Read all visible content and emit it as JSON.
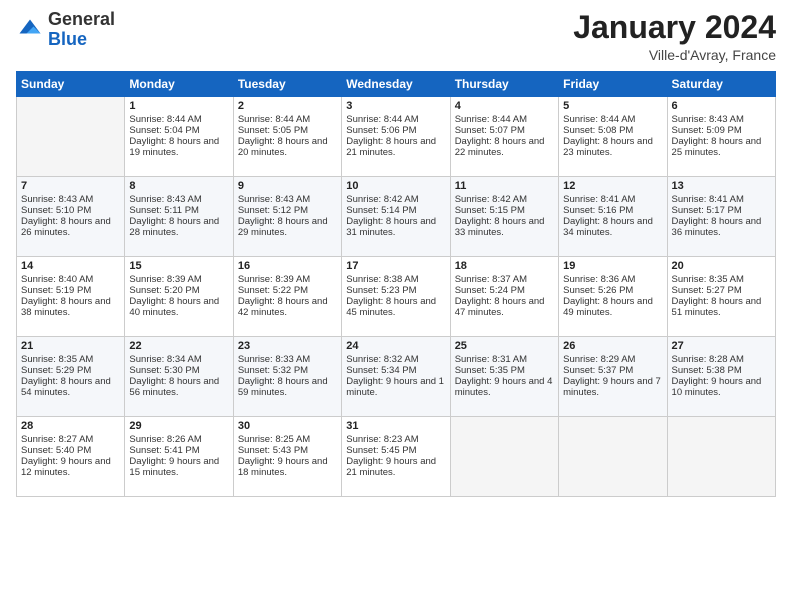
{
  "logo": {
    "general": "General",
    "blue": "Blue"
  },
  "header": {
    "month": "January 2024",
    "location": "Ville-d'Avray, France"
  },
  "days_of_week": [
    "Sunday",
    "Monday",
    "Tuesday",
    "Wednesday",
    "Thursday",
    "Friday",
    "Saturday"
  ],
  "weeks": [
    [
      {
        "day": "",
        "content": ""
      },
      {
        "day": "1",
        "sunrise": "Sunrise: 8:44 AM",
        "sunset": "Sunset: 5:04 PM",
        "daylight": "Daylight: 8 hours and 19 minutes."
      },
      {
        "day": "2",
        "sunrise": "Sunrise: 8:44 AM",
        "sunset": "Sunset: 5:05 PM",
        "daylight": "Daylight: 8 hours and 20 minutes."
      },
      {
        "day": "3",
        "sunrise": "Sunrise: 8:44 AM",
        "sunset": "Sunset: 5:06 PM",
        "daylight": "Daylight: 8 hours and 21 minutes."
      },
      {
        "day": "4",
        "sunrise": "Sunrise: 8:44 AM",
        "sunset": "Sunset: 5:07 PM",
        "daylight": "Daylight: 8 hours and 22 minutes."
      },
      {
        "day": "5",
        "sunrise": "Sunrise: 8:44 AM",
        "sunset": "Sunset: 5:08 PM",
        "daylight": "Daylight: 8 hours and 23 minutes."
      },
      {
        "day": "6",
        "sunrise": "Sunrise: 8:43 AM",
        "sunset": "Sunset: 5:09 PM",
        "daylight": "Daylight: 8 hours and 25 minutes."
      }
    ],
    [
      {
        "day": "7",
        "sunrise": "Sunrise: 8:43 AM",
        "sunset": "Sunset: 5:10 PM",
        "daylight": "Daylight: 8 hours and 26 minutes."
      },
      {
        "day": "8",
        "sunrise": "Sunrise: 8:43 AM",
        "sunset": "Sunset: 5:11 PM",
        "daylight": "Daylight: 8 hours and 28 minutes."
      },
      {
        "day": "9",
        "sunrise": "Sunrise: 8:43 AM",
        "sunset": "Sunset: 5:12 PM",
        "daylight": "Daylight: 8 hours and 29 minutes."
      },
      {
        "day": "10",
        "sunrise": "Sunrise: 8:42 AM",
        "sunset": "Sunset: 5:14 PM",
        "daylight": "Daylight: 8 hours and 31 minutes."
      },
      {
        "day": "11",
        "sunrise": "Sunrise: 8:42 AM",
        "sunset": "Sunset: 5:15 PM",
        "daylight": "Daylight: 8 hours and 33 minutes."
      },
      {
        "day": "12",
        "sunrise": "Sunrise: 8:41 AM",
        "sunset": "Sunset: 5:16 PM",
        "daylight": "Daylight: 8 hours and 34 minutes."
      },
      {
        "day": "13",
        "sunrise": "Sunrise: 8:41 AM",
        "sunset": "Sunset: 5:17 PM",
        "daylight": "Daylight: 8 hours and 36 minutes."
      }
    ],
    [
      {
        "day": "14",
        "sunrise": "Sunrise: 8:40 AM",
        "sunset": "Sunset: 5:19 PM",
        "daylight": "Daylight: 8 hours and 38 minutes."
      },
      {
        "day": "15",
        "sunrise": "Sunrise: 8:39 AM",
        "sunset": "Sunset: 5:20 PM",
        "daylight": "Daylight: 8 hours and 40 minutes."
      },
      {
        "day": "16",
        "sunrise": "Sunrise: 8:39 AM",
        "sunset": "Sunset: 5:22 PM",
        "daylight": "Daylight: 8 hours and 42 minutes."
      },
      {
        "day": "17",
        "sunrise": "Sunrise: 8:38 AM",
        "sunset": "Sunset: 5:23 PM",
        "daylight": "Daylight: 8 hours and 45 minutes."
      },
      {
        "day": "18",
        "sunrise": "Sunrise: 8:37 AM",
        "sunset": "Sunset: 5:24 PM",
        "daylight": "Daylight: 8 hours and 47 minutes."
      },
      {
        "day": "19",
        "sunrise": "Sunrise: 8:36 AM",
        "sunset": "Sunset: 5:26 PM",
        "daylight": "Daylight: 8 hours and 49 minutes."
      },
      {
        "day": "20",
        "sunrise": "Sunrise: 8:35 AM",
        "sunset": "Sunset: 5:27 PM",
        "daylight": "Daylight: 8 hours and 51 minutes."
      }
    ],
    [
      {
        "day": "21",
        "sunrise": "Sunrise: 8:35 AM",
        "sunset": "Sunset: 5:29 PM",
        "daylight": "Daylight: 8 hours and 54 minutes."
      },
      {
        "day": "22",
        "sunrise": "Sunrise: 8:34 AM",
        "sunset": "Sunset: 5:30 PM",
        "daylight": "Daylight: 8 hours and 56 minutes."
      },
      {
        "day": "23",
        "sunrise": "Sunrise: 8:33 AM",
        "sunset": "Sunset: 5:32 PM",
        "daylight": "Daylight: 8 hours and 59 minutes."
      },
      {
        "day": "24",
        "sunrise": "Sunrise: 8:32 AM",
        "sunset": "Sunset: 5:34 PM",
        "daylight": "Daylight: 9 hours and 1 minute."
      },
      {
        "day": "25",
        "sunrise": "Sunrise: 8:31 AM",
        "sunset": "Sunset: 5:35 PM",
        "daylight": "Daylight: 9 hours and 4 minutes."
      },
      {
        "day": "26",
        "sunrise": "Sunrise: 8:29 AM",
        "sunset": "Sunset: 5:37 PM",
        "daylight": "Daylight: 9 hours and 7 minutes."
      },
      {
        "day": "27",
        "sunrise": "Sunrise: 8:28 AM",
        "sunset": "Sunset: 5:38 PM",
        "daylight": "Daylight: 9 hours and 10 minutes."
      }
    ],
    [
      {
        "day": "28",
        "sunrise": "Sunrise: 8:27 AM",
        "sunset": "Sunset: 5:40 PM",
        "daylight": "Daylight: 9 hours and 12 minutes."
      },
      {
        "day": "29",
        "sunrise": "Sunrise: 8:26 AM",
        "sunset": "Sunset: 5:41 PM",
        "daylight": "Daylight: 9 hours and 15 minutes."
      },
      {
        "day": "30",
        "sunrise": "Sunrise: 8:25 AM",
        "sunset": "Sunset: 5:43 PM",
        "daylight": "Daylight: 9 hours and 18 minutes."
      },
      {
        "day": "31",
        "sunrise": "Sunrise: 8:23 AM",
        "sunset": "Sunset: 5:45 PM",
        "daylight": "Daylight: 9 hours and 21 minutes."
      },
      {
        "day": "",
        "content": ""
      },
      {
        "day": "",
        "content": ""
      },
      {
        "day": "",
        "content": ""
      }
    ]
  ]
}
